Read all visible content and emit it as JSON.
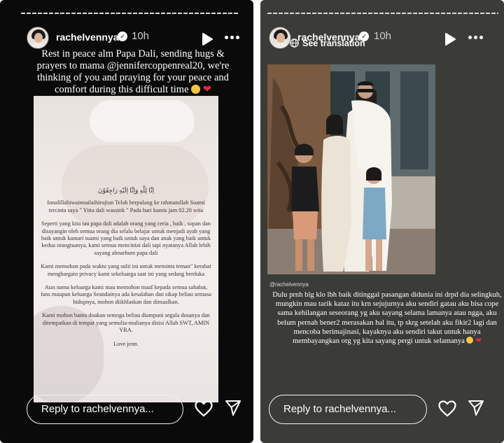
{
  "left_story": {
    "username": "rachelvennya",
    "time": "10h",
    "caption_text": "Rest in peace alm Papa Dali, sending hugs & prayers to mama @jennifercoppenreal20, we're thinking of you and praying for your peace and comfort during this difficult time",
    "memo": {
      "arabic": "اِنَّا لِلّٰهِ وَاِنَّا اِلَيْهِ رَاجِعُوْنَ",
      "p1": "Innalillahiwainnailaihirojiun Telah berpulang ke rahmatullah Suami tercinta saya \" Yitta dali wassink \" Pada hari kamis jam 02.20 wita",
      "p2": "Seperti yang kita tau papa dali adalah orang yang ceria , baik , sopan dan disayangin oleh semua orang dia selalu belajar untuk menjadi ayah yang baik untuk kamari suami yang baik untuk saya dan anak yang baik untuk kedua orangtuanya, kami semua mencintai dali tapi nyatanya Allah lebih sayang almarhum papa dali",
      "p3": "Kami memohon pada waktu yang sulit ini untuk meminta teman\" kerabat menghargain privacy kami sekeluarga saat ini yang sedang berduka",
      "p4": "Atas nama keluarga kami mau memohon maaf kepada semua sahabat, fans maupun keluarga Seandainya ada kesalahan dan sikap beliau semasa hidupnya, mohon diikhlaskan dan dimaafkan.",
      "p5": "Kami mohon bantu doakan semoga beliau diampuni segala dosanya dan ditempatkan di tempat yang semulia-mulianya disisi Allah SWT, AMIN YRA.",
      "p6": "Love jenn."
    },
    "reply_placeholder": "Reply to rachelvennya..."
  },
  "right_story": {
    "username": "rachelvennya",
    "time": "10h",
    "see_translation": "See translation",
    "photo_credit": "@rachelvennya",
    "caption_text": "Dulu prnh blg klo lbh baik ditinggal pasangan diduniа ini drpd dia selingkuh, mungkin mau tarik kataz itu krn sejujurnya aku sendiri gatau aku bisa cope sama kehilangan seseorang yg aku sayang selama lamanya atau ngga, aku belum pernah bener2 merasakan hal itu, tp skrg setelah aku fikir2 lagi dan mencoba berimajinasi, kayaknya aku sendiri takut untuk hanya membayangkan org yg kita sayang pergi untuk selamanya",
    "reply_placeholder": "Reply to rachelvennya..."
  },
  "icons": {
    "verified": "verified-badge-icon",
    "play": "play-icon",
    "more": "more-options-icon",
    "heart": "heart-icon",
    "send": "send-icon",
    "globe": "globe-icon"
  },
  "colors": {
    "left_background": "#0a0a0a",
    "right_background": "#3b3b38",
    "heart_emoji": "#e0283a",
    "emoji_face": "#f6c443"
  }
}
